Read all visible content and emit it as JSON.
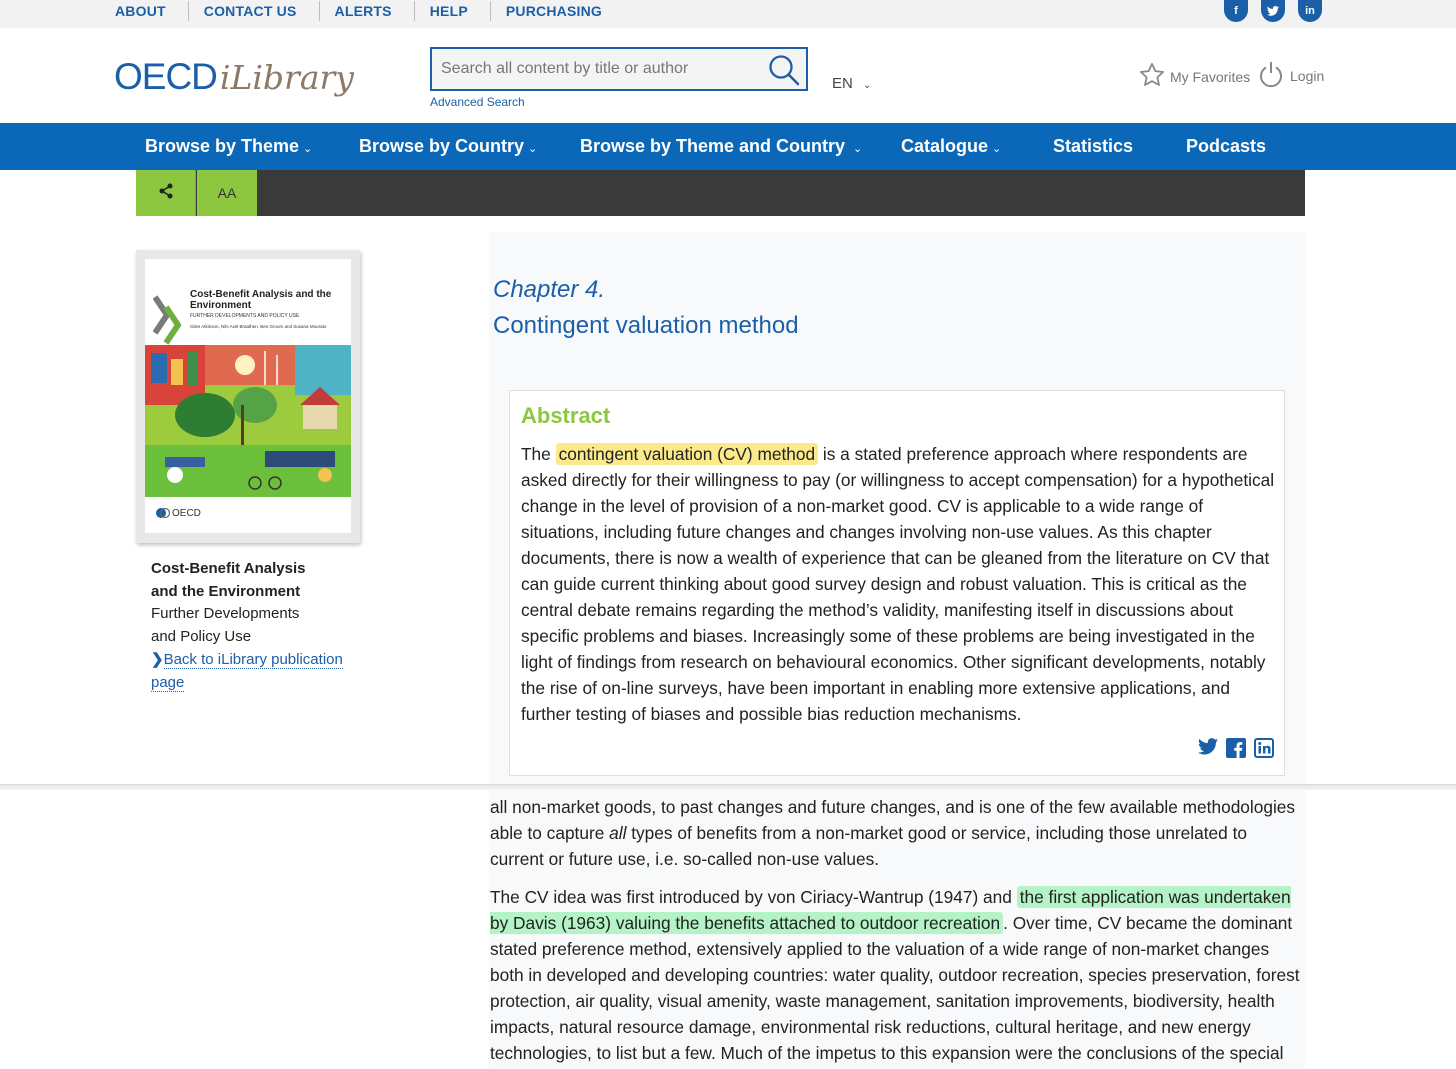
{
  "topbar": {
    "links": [
      "ABOUT",
      "CONTACT US",
      "ALERTS",
      "HELP",
      "PURCHASING"
    ],
    "social": [
      "f",
      "t",
      "in"
    ]
  },
  "header": {
    "logo_main": "OECD",
    "logo_sub": "iLibrary",
    "search_placeholder": "Search all content by title or author",
    "advanced_search": "Advanced Search",
    "language": "EN",
    "favorites": "My Favorites",
    "login": "Login"
  },
  "nav": {
    "items": [
      "Browse by Theme",
      "Browse by Country",
      "Browse by Theme and Country",
      "Catalogue",
      "Statistics",
      "Podcasts"
    ]
  },
  "toolbar": {
    "share_icon": "share-icon",
    "text_size_label": "AA"
  },
  "book": {
    "cover_title": "Cost-Benefit Analysis and the Environment",
    "cover_subtitle": "FURTHER DEVELOPMENTS AND POLICY USE",
    "cover_authors": "Giles Atkinson, Nils Axel Braathen, Ben Groom and Susana Mourato",
    "cover_publisher": "OECD",
    "title_line1": "Cost-Benefit Analysis",
    "title_line2": "and the Environment",
    "subtitle_line1": "Further Developments",
    "subtitle_line2": "and Policy Use",
    "back_link": "Back to iLibrary publication page"
  },
  "article": {
    "chapter_label": "Chapter 4.",
    "chapter_title": "Contingent valuation method",
    "abstract_heading": "Abstract",
    "abstract_pre": "The ",
    "abstract_highlight": "contingent valuation (CV) method",
    "abstract_post": " is a stated preference approach where respondents are asked directly for their willingness to pay (or willingness to accept compensation) for a hypothetical change in the level of provision of a non-market good. CV is applicable to a wide range of situations, including future changes and changes involving non-use values. As this chapter documents, there is now a wealth of experience that can be gleaned from the literature on CV that can guide current thinking about good survey design and robust valuation. This is critical as the central debate remains regarding the method’s validity, manifesting itself in discussions about specific problems and biases. Increasingly some of these problems are being investigated in the light of findings from research on behavioural economics. Other significant developments, notably the rise of on-line surveys, have been important in enabling more extensive applications, and further testing of biases and possible bias reduction mechanisms.",
    "para1_pre": "all non-market goods, to past changes and future changes, and is one of the few available methodologies able to capture ",
    "para1_italic": "all",
    "para1_post": " types of benefits from a non-market good or service, including those unrelated to current or future use, i.e. so-called non-use values.",
    "para2_pre": "The CV idea was first introduced by von Ciriacy-Wantrup (1947) and ",
    "para2_highlight": "the first application was undertaken by Davis (1963) valuing the benefits attached to outdoor recreation",
    "para2_post": ". Over time, CV became the dominant stated preference method, extensively applied to the valuation of a wide range of non-market changes both in developed and developing countries: water quality, outdoor recreation, species preservation, forest protection, air quality, visual amenity, waste management, sanitation improvements, biodiversity, health impacts, natural resource damage, environmental risk reductions, cultural heritage, and new energy technologies, to list but a few. Much of the impetus to this expansion were the conclusions of the special"
  },
  "colors": {
    "brand_blue": "#0b67b8",
    "link_blue": "#1b5fa8",
    "accent_green": "#8dc63f",
    "highlight_yellow": "#fbe98a",
    "highlight_green": "#b4f3c5"
  }
}
